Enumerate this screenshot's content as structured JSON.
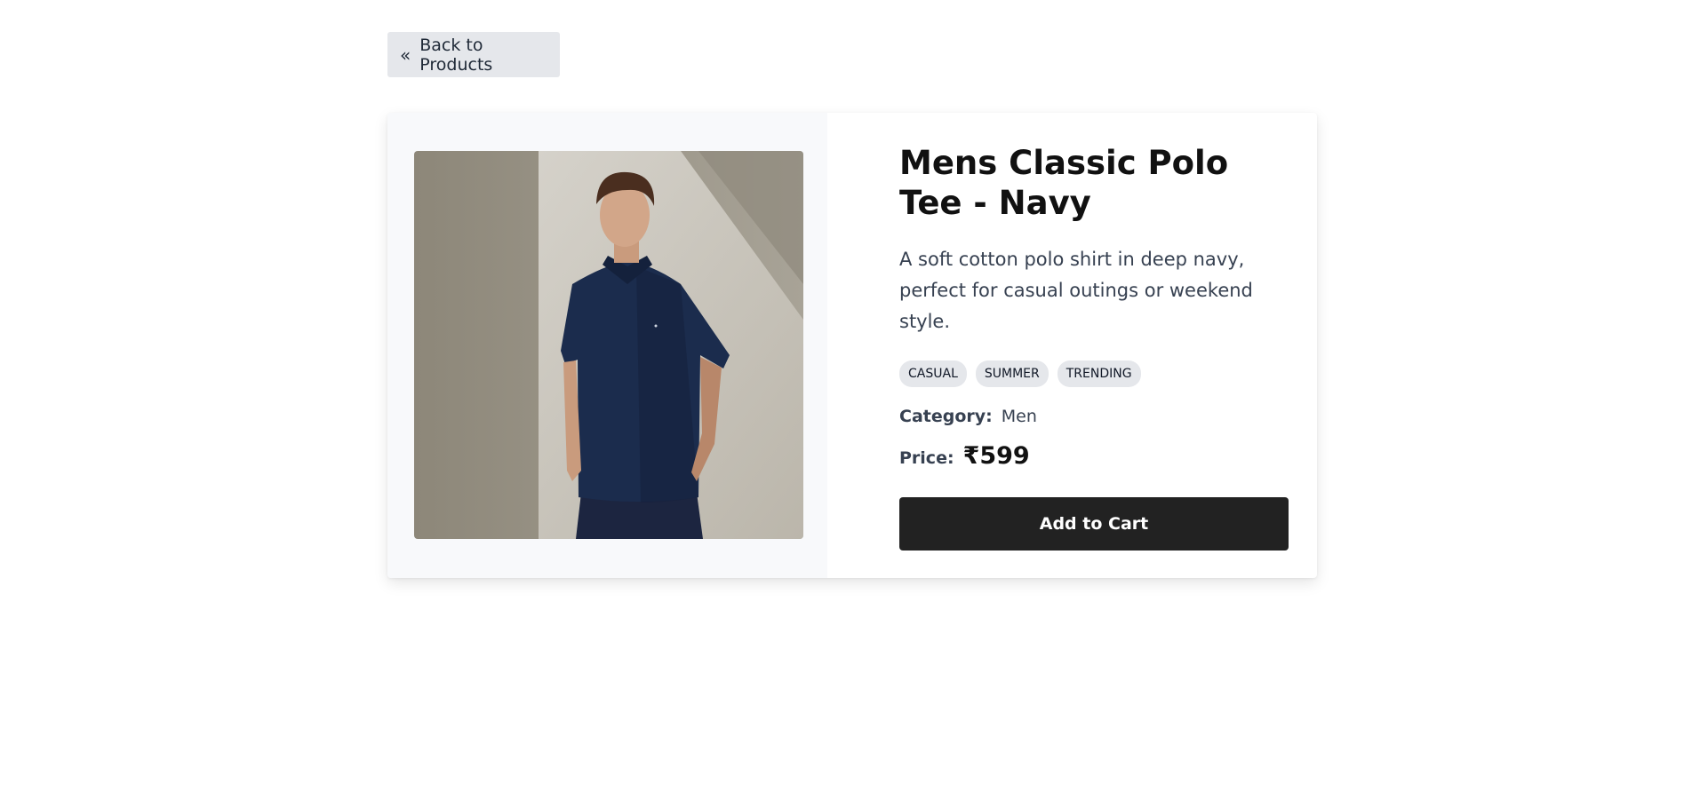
{
  "nav": {
    "back_label": "Back to Products",
    "back_icon": "double-chevron-left-icon"
  },
  "product": {
    "title": "Mens Classic Polo Tee - Navy",
    "description": "A soft cotton polo shirt in deep navy, perfect for casual outings or weekend style.",
    "tags": [
      "CASUAL",
      "SUMMER",
      "TRENDING"
    ],
    "category_label": "Category:",
    "category": "Men",
    "price_label": "Price:",
    "price": "₹599",
    "image_subject": "man-wearing-navy-polo-shirt"
  },
  "actions": {
    "add_to_cart_label": "Add to Cart"
  },
  "colors": {
    "button_dark": "#222222",
    "tag_bg": "#e5e7eb",
    "image_panel_bg": "#f8f9fb",
    "shirt_navy": "#1b2c4d"
  }
}
